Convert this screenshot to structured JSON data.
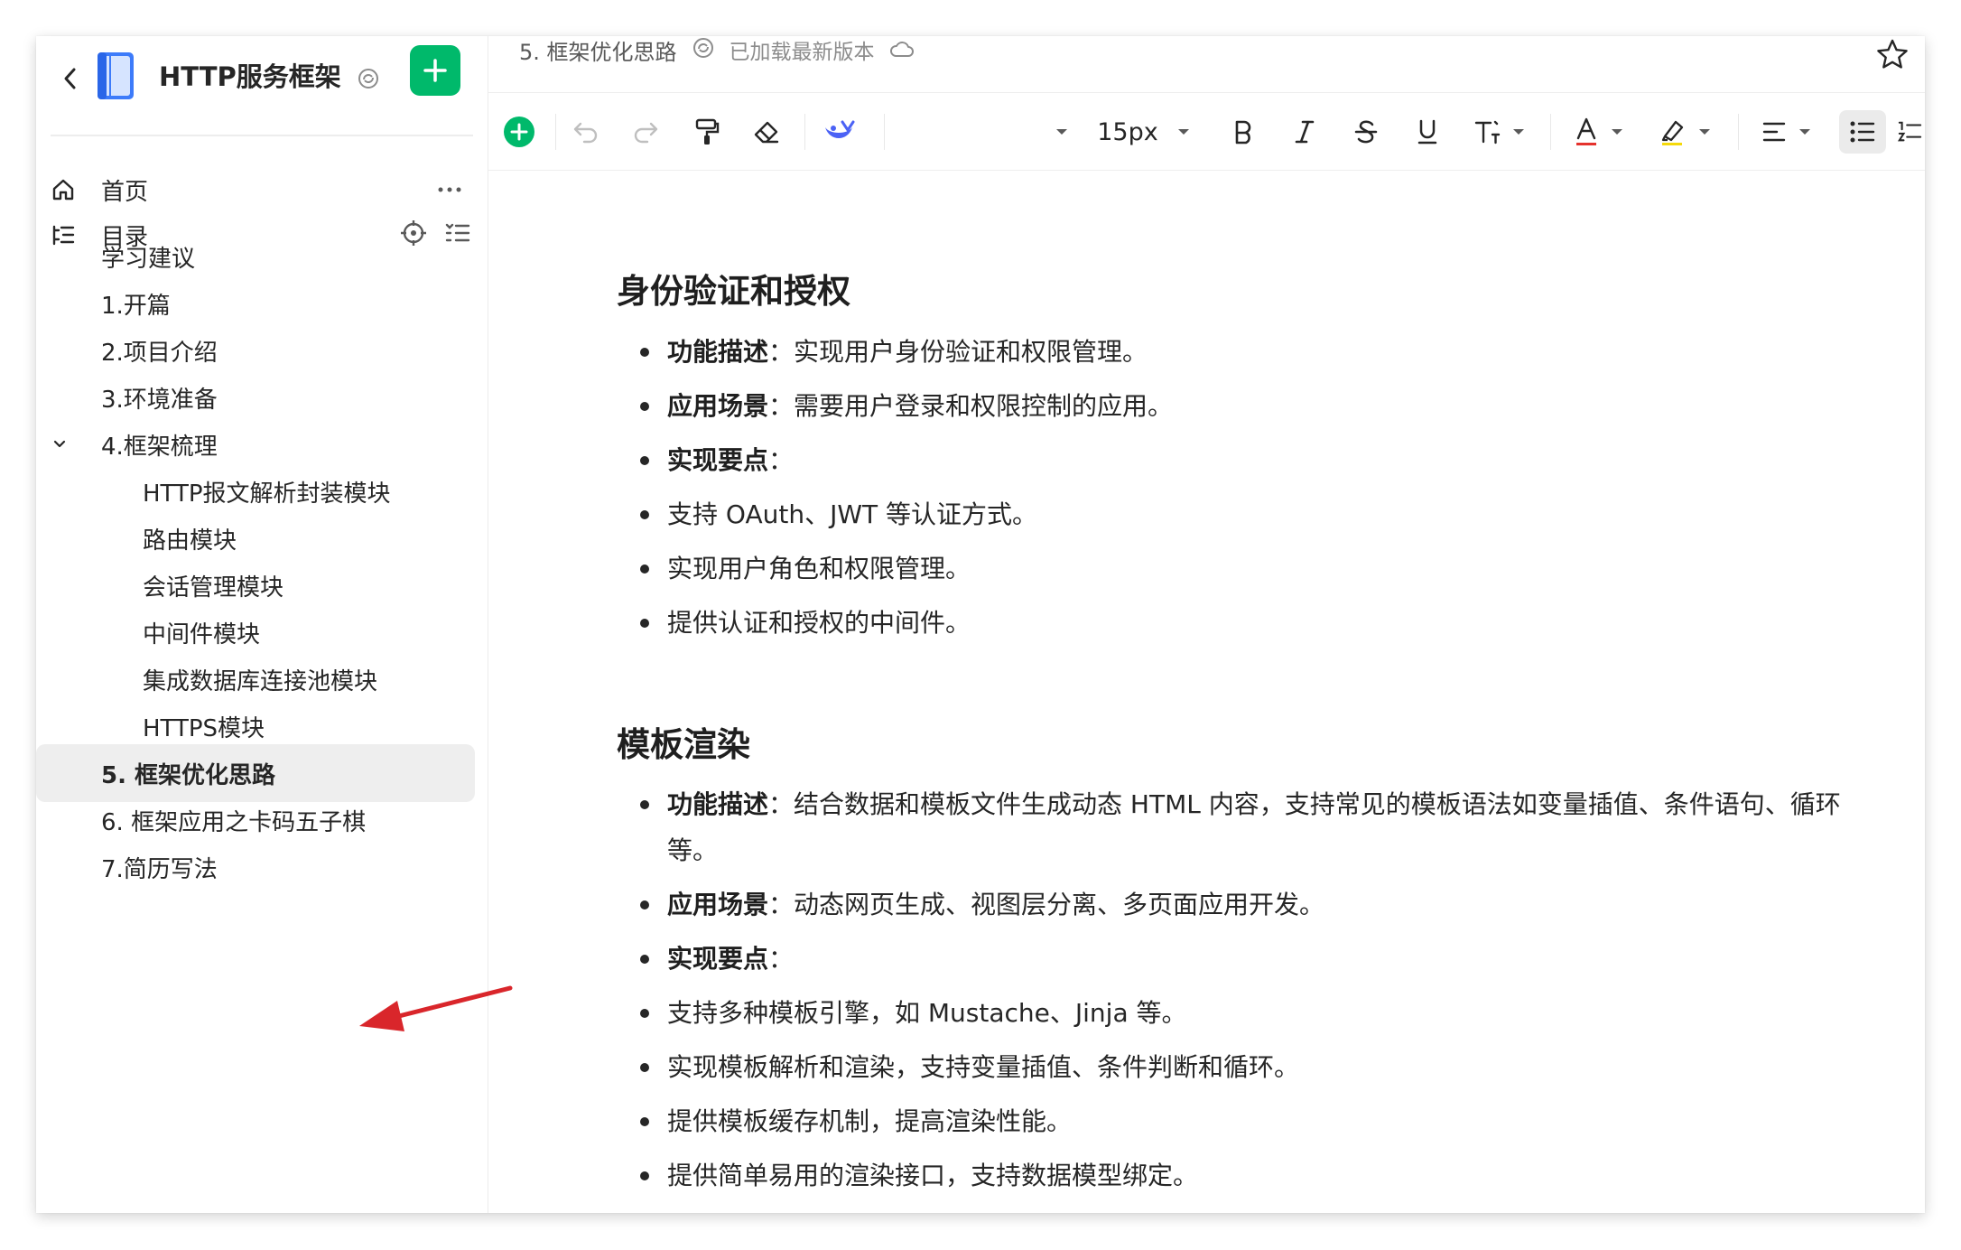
{
  "sidebar": {
    "book_title": "HTTP服务框架",
    "nav": {
      "home_label": "首页",
      "toc_label": "目录"
    },
    "toc": [
      {
        "label": "学习建议"
      },
      {
        "label": "1.开篇"
      },
      {
        "label": "2.项目介绍"
      },
      {
        "label": "3.环境准备"
      },
      {
        "label": "4.框架梳理"
      },
      {
        "label": "HTTP报文解析封装模块"
      },
      {
        "label": "路由模块"
      },
      {
        "label": "会话管理模块"
      },
      {
        "label": "中间件模块"
      },
      {
        "label": "集成数据库连接池模块"
      },
      {
        "label": "HTTPS模块"
      },
      {
        "label": "5. 框架优化思路"
      },
      {
        "label": "6. 框架应用之卡码五子棋"
      },
      {
        "label": "7.简历写法"
      }
    ],
    "selected": "5. 框架优化思路"
  },
  "header": {
    "doc_title": "5. 框架优化思路",
    "save_status": "已加载最新版本"
  },
  "toolbar": {
    "font_size": "15px"
  },
  "content": {
    "sections": [
      {
        "heading": "身份验证和授权",
        "items": [
          {
            "bold": "功能描述",
            "sep": "：",
            "text": "实现用户身份验证和权限管理。"
          },
          {
            "bold": "应用场景",
            "sep": "：",
            "text": "需要用户登录和权限控制的应用。"
          },
          {
            "bold": "实现要点",
            "sep": "：",
            "text": ""
          },
          {
            "bold": "",
            "sep": "",
            "text": "支持 OAuth、JWT 等认证方式。"
          },
          {
            "bold": "",
            "sep": "",
            "text": "实现用户角色和权限管理。"
          },
          {
            "bold": "",
            "sep": "",
            "text": "提供认证和授权的中间件。"
          }
        ]
      },
      {
        "heading": "模板渲染",
        "items": [
          {
            "bold": "功能描述",
            "sep": "：",
            "text": "结合数据和模板文件生成动态 HTML 内容，支持常见的模板语法如变量插值、条件语句、循环"
          },
          {
            "bold": "",
            "sep": "",
            "text": "等。"
          },
          {
            "bold": "应用场景",
            "sep": "：",
            "text": "动态网页生成、视图层分离、多页面应用开发。"
          },
          {
            "bold": "实现要点",
            "sep": "：",
            "text": ""
          },
          {
            "bold": "",
            "sep": "",
            "text": "支持多种模板引擎，如 Mustache、Jinja 等。"
          },
          {
            "bold": "",
            "sep": "",
            "text": "实现模板解析和渲染，支持变量插值、条件判断和循环。"
          },
          {
            "bold": "",
            "sep": "",
            "text": "提供模板缓存机制，提高渲染性能。"
          },
          {
            "bold": "",
            "sep": "",
            "text": "提供简单易用的渲染接口，支持数据模型绑定。"
          }
        ]
      }
    ]
  },
  "colors": {
    "brand_green": "#00b96b",
    "annotation_red": "#d9262b",
    "selected_bg": "#eeeeee",
    "font_color_underline": "#e5322d",
    "highlight_underline": "#f5d90a"
  }
}
